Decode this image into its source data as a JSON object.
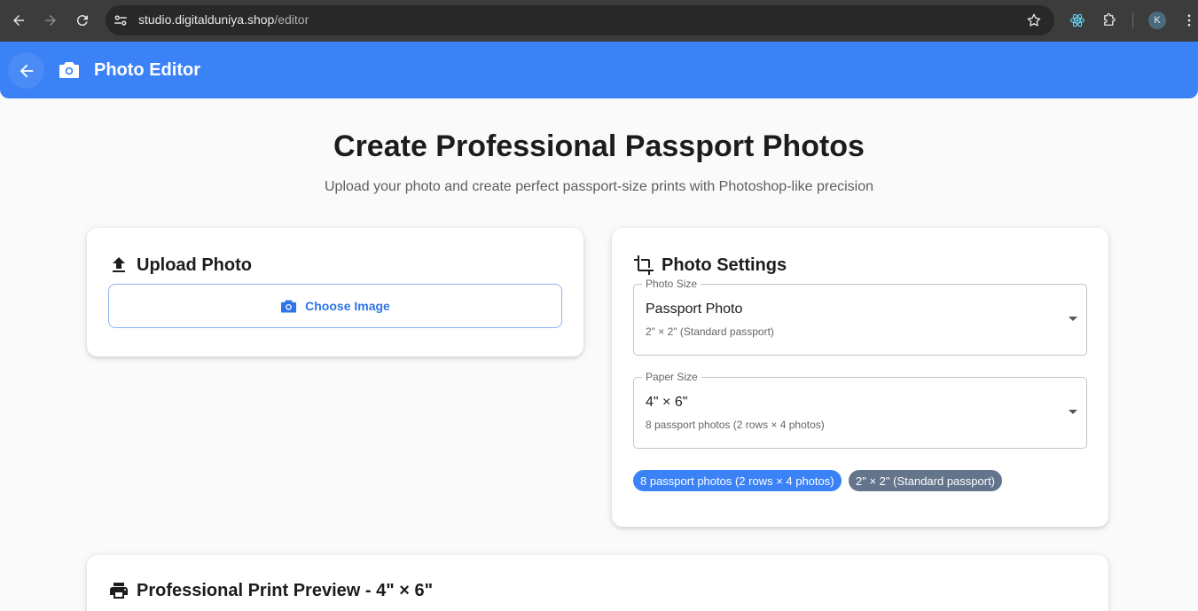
{
  "browser": {
    "url_host": "studio.digitalduniya.shop",
    "url_path": "/editor",
    "profile_initial": "K",
    "icons": [
      "back-arrow-icon",
      "forward-arrow-icon",
      "reload-icon",
      "site-settings-icon",
      "bookmark-star-icon",
      "react-extension-icon",
      "extensions-puzzle-icon",
      "menu-dots-icon"
    ]
  },
  "appbar": {
    "title": "Photo Editor",
    "color": "#3b82f6"
  },
  "hero": {
    "title": "Create Professional Passport Photos",
    "subtitle": "Upload your photo and create perfect passport-size prints with Photoshop-like precision"
  },
  "upload": {
    "title": "Upload Photo",
    "button_label": "Choose Image"
  },
  "settings": {
    "title": "Photo Settings",
    "photo_size": {
      "label": "Photo Size",
      "value": "Passport Photo",
      "description": "2\" × 2\" (Standard passport)"
    },
    "paper_size": {
      "label": "Paper Size",
      "value": "4\" × 6\"",
      "description": "8 passport photos (2 rows × 4 photos)"
    },
    "chips": [
      "8 passport photos (2 rows × 4 photos)",
      "2\" × 2\" (Standard passport)"
    ]
  },
  "preview": {
    "title": "Professional Print Preview - 4\" × 6\""
  }
}
